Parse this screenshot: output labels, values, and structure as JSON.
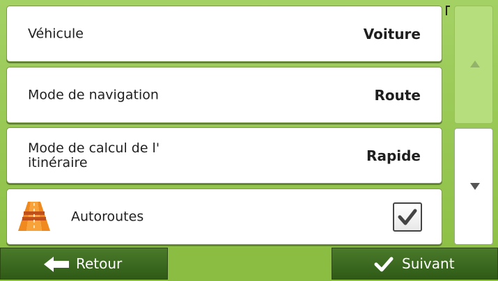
{
  "settings": [
    {
      "label": "Véhicule",
      "value": "Voiture"
    },
    {
      "label": "Mode de navigation",
      "value": "Route"
    },
    {
      "label": "Mode de calcul de l' itinéraire",
      "value": "Rapide"
    }
  ],
  "motorways": {
    "label": "Autoroutes",
    "checked": true,
    "icon": "motorway-icon"
  },
  "footer": {
    "back_label": "Retour",
    "next_label": "Suivant"
  },
  "colors": {
    "accent_green": "#8ec046",
    "button_dark": "#2f5a17",
    "road_orange": "#f08a1e"
  }
}
